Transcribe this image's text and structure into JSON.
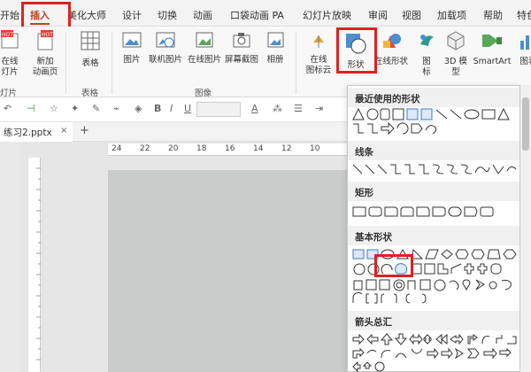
{
  "colors": {
    "accent": "#b7472a",
    "highlight": "#e02020"
  },
  "tabs": [
    "开始",
    "插入",
    "美化大师",
    "设计",
    "切换",
    "动画",
    "口袋动画 PA",
    "幻灯片放映",
    "审阅",
    "视图",
    "加载项",
    "帮助",
    "特色"
  ],
  "ribbon": {
    "btn_online_slide": "在线\n灯片",
    "btn_new_anim": "新加\n动画页",
    "btn_table": "表格",
    "btn_picture": "图片",
    "btn_online_picture": "联机图片",
    "btn_online_img": "在线图片",
    "btn_screenshot": "屏幕截图",
    "btn_album": "相册",
    "btn_online_icon": "在线\n图标云",
    "btn_shapes": "形状",
    "btn_online_shapes": "在线形状",
    "btn_icons": "图\n标",
    "btn_3d": "3D 模\n型",
    "btn_smartart": "SmartArt",
    "btn_chart": "图表",
    "group_slides": "灯片",
    "group_table": "表格",
    "group_images": "图像",
    "hot_label": "HOT"
  },
  "toolbar": {
    "bold": "B",
    "italic": "I",
    "underline": "U",
    "font_a": "A"
  },
  "file_tab": {
    "name": "练习2.pptx",
    "close": "×",
    "add": "+"
  },
  "ruler": {
    "h_numbers": [
      "24",
      "22",
      "20",
      "18",
      "16",
      "14",
      "12",
      "10"
    ]
  },
  "dropdown": {
    "sections": [
      "最近使用的形状",
      "线条",
      "矩形",
      "基本形状",
      "箭头总汇"
    ]
  }
}
